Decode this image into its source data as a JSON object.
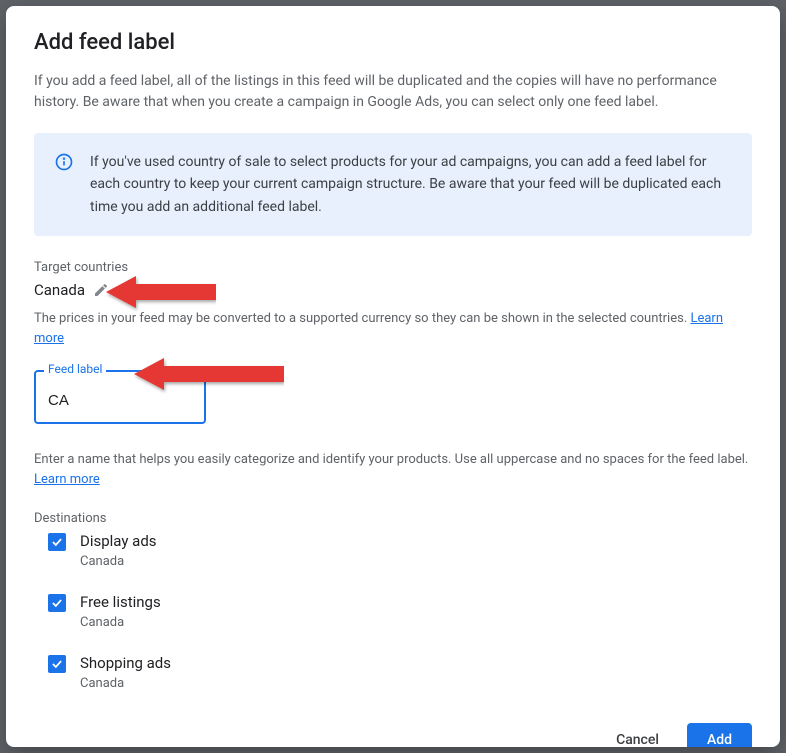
{
  "dialog": {
    "title": "Add feed label",
    "intro": "If you add a feed label, all of the listings in this feed will be duplicated and the copies will have no performance history. Be aware that when you create a campaign in Google Ads, you can select only one feed label.",
    "infobox": "If you've used country of sale to select products for your ad campaigns, you can add a feed label for each country to keep your current campaign structure. Be aware that your feed will be duplicated each time you add an additional feed label."
  },
  "target_countries": {
    "label": "Target countries",
    "value": "Canada",
    "helper": "The prices in your feed may be converted to a supported currency so they can be shown in the selected countries. ",
    "learn_more": "Learn more"
  },
  "feed_label": {
    "label": "Feed label",
    "value": "CA",
    "helper": "Enter a name that helps you easily categorize and identify your products. Use all uppercase and no spaces for the feed label. ",
    "learn_more": "Learn more"
  },
  "destinations": {
    "label": "Destinations",
    "items": [
      {
        "label": "Display ads",
        "sub": "Canada",
        "checked": true
      },
      {
        "label": "Free listings",
        "sub": "Canada",
        "checked": true
      },
      {
        "label": "Shopping ads",
        "sub": "Canada",
        "checked": true
      }
    ]
  },
  "actions": {
    "cancel": "Cancel",
    "add": "Add"
  }
}
